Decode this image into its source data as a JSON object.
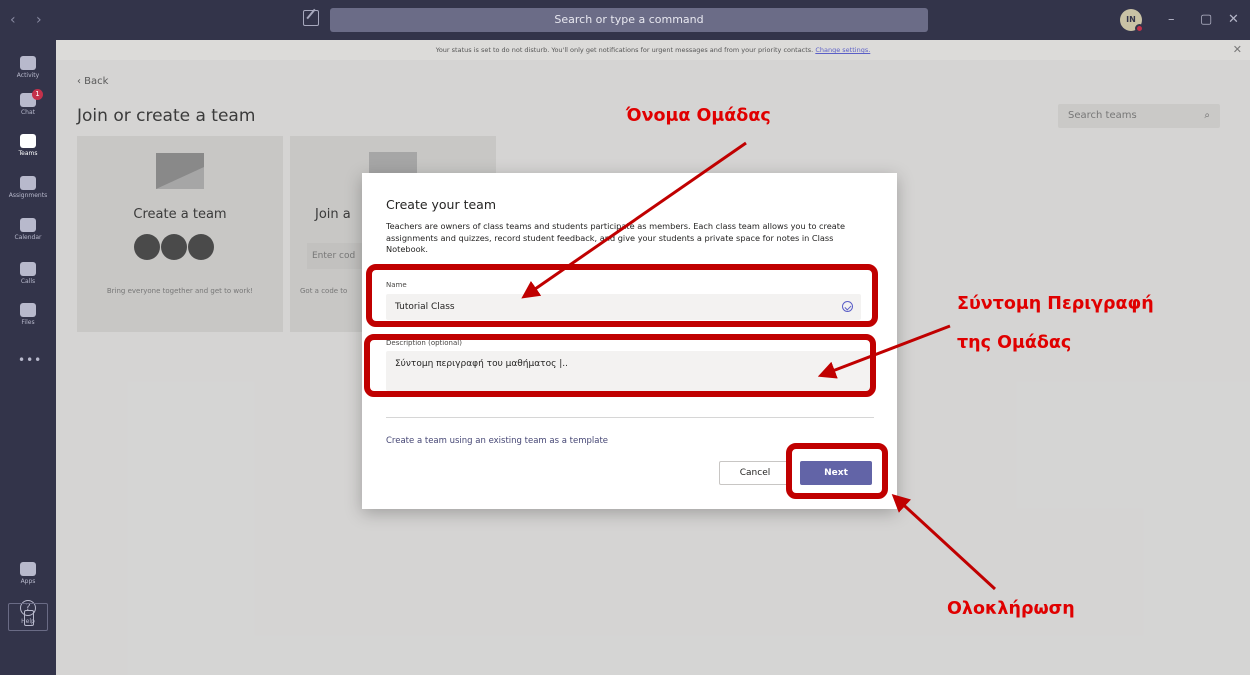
{
  "titlebar": {
    "nav_arrows": "‹ ›",
    "search_placeholder": "Search or type a command",
    "avatar_initials": "IN",
    "controls": [
      "–",
      "▢",
      "✕"
    ]
  },
  "rail": {
    "items": [
      {
        "label": "Activity",
        "icon": "bell-icon"
      },
      {
        "label": "Chat",
        "icon": "chat-icon",
        "badge": "1"
      },
      {
        "label": "Teams",
        "icon": "teams-icon",
        "active": true
      },
      {
        "label": "Assignments",
        "icon": "assignments-icon"
      },
      {
        "label": "Calendar",
        "icon": "calendar-icon"
      },
      {
        "label": "Calls",
        "icon": "phone-icon"
      },
      {
        "label": "Files",
        "icon": "file-icon"
      }
    ],
    "more": "•••",
    "apps_label": "Apps",
    "help_label": "Help",
    "help_glyph": "?"
  },
  "notice": {
    "text": "Your status is set to do not disturb. You'll only get notifications for urgent messages and from your priority contacts. ",
    "link": "Change settings.",
    "close": "✕"
  },
  "main": {
    "back": "‹  Back",
    "title": "Join or create a team",
    "search_teams": "Search teams",
    "create_card": {
      "title": "Create a team",
      "desc": "Bring everyone together and get to work!"
    },
    "join_card": {
      "title": "Join a",
      "input_placeholder": "Enter cod",
      "desc": "Got a code to"
    }
  },
  "dialog": {
    "title": "Create your team",
    "description": "Teachers are owners of class teams and students participate as members. Each class team allows you to create assignments and quizzes, record student feedback, and give your students a private space for notes in Class Notebook.",
    "name_label": "Name",
    "name_value": "Tutorial Class",
    "desc_label": "Description (optional)",
    "desc_value": "Σύντομη περιγραφή του μαθήματος |..",
    "template_link": "Create a team using an existing team as a template",
    "cancel": "Cancel",
    "next": "Next"
  },
  "annotations": {
    "team_name": "Όνομα Ομάδας",
    "short_desc_line1": "Σύντομη Περιγραφή",
    "short_desc_line2": "της Ομάδας",
    "finish": "Ολοκλήρωση",
    "color": "#e00000"
  }
}
